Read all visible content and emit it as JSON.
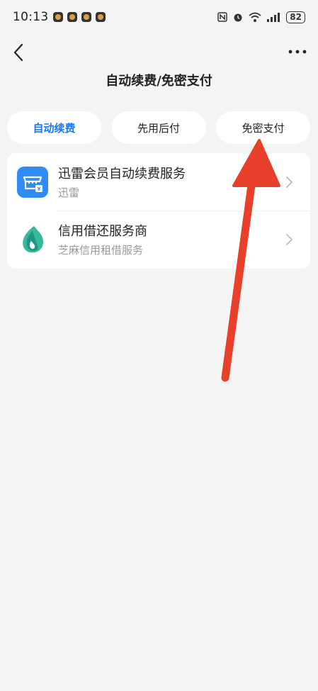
{
  "status_bar": {
    "time": "10:13",
    "battery": "82"
  },
  "header": {
    "title": "自动续费/免密支付"
  },
  "tabs": [
    {
      "label": "自动续费",
      "active": true
    },
    {
      "label": "先用后付",
      "active": false
    },
    {
      "label": "免密支付",
      "active": false
    }
  ],
  "list": {
    "items": [
      {
        "title": "迅雷会员自动续费服务",
        "subtitle": "迅雷",
        "icon": "xunlei-icon"
      },
      {
        "title": "信用借还服务商",
        "subtitle": "芝麻信用租借服务",
        "icon": "zhima-credit-icon"
      }
    ]
  },
  "colors": {
    "accent": "#1677ff",
    "annotation": "#e8402a",
    "background": "#f4f4f4"
  }
}
